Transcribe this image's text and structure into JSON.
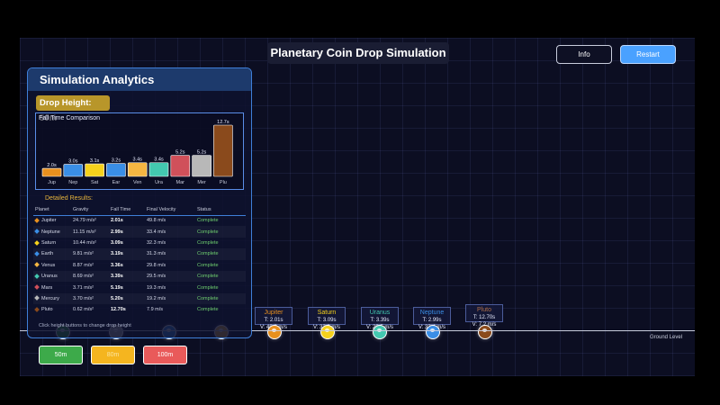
{
  "app": {
    "title": "Planetary Coin Drop Simulation",
    "info_label": "Info",
    "restart_label": "Restart",
    "ground_label": "Ground Level"
  },
  "lanes": [
    {
      "name": "Jupiter",
      "time": "T: 2.01s",
      "vel": "V: 49.8 m/s",
      "color": "#e8901e"
    },
    {
      "name": "Saturn",
      "time": "T: 3.09s",
      "vel": "V: 32.3 m/s",
      "color": "#f6d21c"
    },
    {
      "name": "Uranus",
      "time": "T: 3.39s",
      "vel": "V: 29.5 m/s",
      "color": "#43c8b0"
    },
    {
      "name": "Neptune",
      "time": "T: 2.99s",
      "vel": "V: 33.4 m/s",
      "color": "#3a8ee6"
    },
    {
      "name": "Pluto",
      "time": "T: 12.70s",
      "vel": "V: 7.2 m/s",
      "color": "#8a4a1c"
    }
  ],
  "panel": {
    "title": "Simulation Analytics",
    "drop_height": "Drop Height: 50m",
    "chart_title": "Fall Time Comparison",
    "detailed_title": "Detailed Results:",
    "hint": "Click height buttons to change drop height",
    "columns": [
      "Planet",
      "Gravity",
      "Fall Time",
      "Final Velocity",
      "Status"
    ],
    "rows": [
      {
        "planet": "Jupiter",
        "gravity": "24.79 m/s²",
        "time": "2.01s",
        "velocity": "49.8 m/s",
        "status": "Complete",
        "color": "#e8901e"
      },
      {
        "planet": "Neptune",
        "gravity": "11.15 m/s²",
        "time": "2.99s",
        "velocity": "33.4 m/s",
        "status": "Complete",
        "color": "#3a8ee6"
      },
      {
        "planet": "Saturn",
        "gravity": "10.44 m/s²",
        "time": "3.09s",
        "velocity": "32.3 m/s",
        "status": "Complete",
        "color": "#f6d21c"
      },
      {
        "planet": "Earth",
        "gravity": "9.81 m/s²",
        "time": "3.19s",
        "velocity": "31.3 m/s",
        "status": "Complete",
        "color": "#3a8ee6"
      },
      {
        "planet": "Venus",
        "gravity": "8.87 m/s²",
        "time": "3.36s",
        "velocity": "29.8 m/s",
        "status": "Complete",
        "color": "#f5b642"
      },
      {
        "planet": "Uranus",
        "gravity": "8.69 m/s²",
        "time": "3.39s",
        "velocity": "29.5 m/s",
        "status": "Complete",
        "color": "#43c8b0"
      },
      {
        "planet": "Mars",
        "gravity": "3.71 m/s²",
        "time": "5.19s",
        "velocity": "19.3 m/s",
        "status": "Complete",
        "color": "#d0505a"
      },
      {
        "planet": "Mercury",
        "gravity": "3.70 m/s²",
        "time": "5.20s",
        "velocity": "19.2 m/s",
        "status": "Complete",
        "color": "#b8b8b8"
      },
      {
        "planet": "Pluto",
        "gravity": "0.62 m/s²",
        "time": "12.70s",
        "velocity": "7.9 m/s",
        "status": "Complete",
        "color": "#8a4a1c"
      }
    ]
  },
  "height_buttons": {
    "b50": "50m",
    "b80": "80m",
    "b100": "100m"
  },
  "chart_data": {
    "type": "bar",
    "title": "Fall Time Comparison",
    "categories": [
      "Jup",
      "Nep",
      "Sat",
      "Ear",
      "Ven",
      "Ura",
      "Mar",
      "Mer",
      "Plu"
    ],
    "values": [
      2.0,
      3.0,
      3.1,
      3.2,
      3.4,
      3.4,
      5.2,
      5.2,
      12.7
    ],
    "labels": [
      "2.0s",
      "3.0s",
      "3.1s",
      "3.2s",
      "3.4s",
      "3.4s",
      "5.2s",
      "5.2s",
      "12.7s"
    ],
    "colors": [
      "#e8901e",
      "#3a8ee6",
      "#f6d21c",
      "#3a8ee6",
      "#f5b642",
      "#43c8b0",
      "#d0505a",
      "#b8b8b8",
      "#8a4a1c"
    ],
    "ylim": [
      0,
      12.7
    ]
  }
}
